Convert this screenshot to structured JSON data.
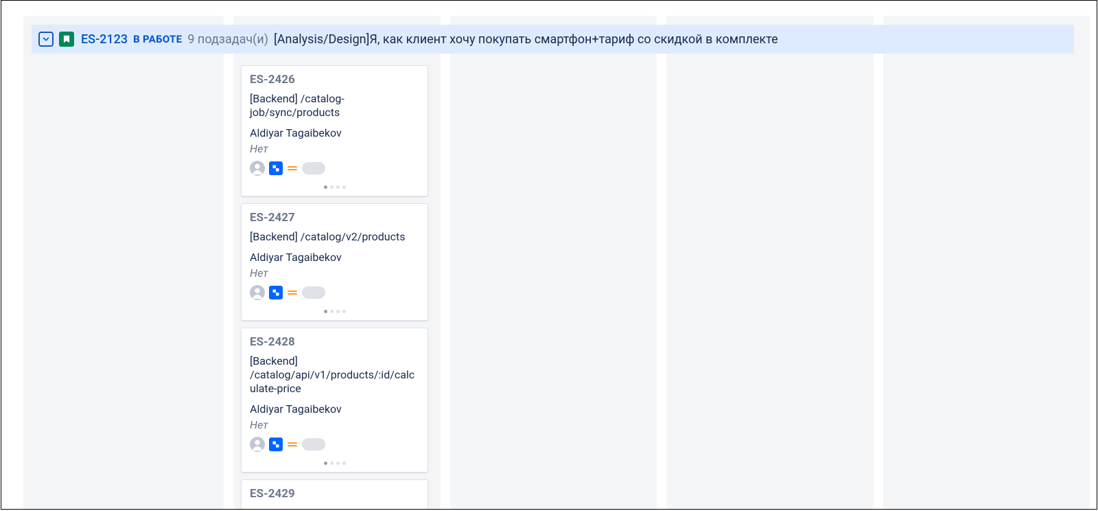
{
  "swimlane": {
    "key": "ES-2123",
    "status": "В РАБОТЕ",
    "subtask_count_label": "9 подзадач(и)",
    "summary": "[Analysis/Design]Я, как клиент хочу покупать смартфон+тариф со скидкой в комплекте"
  },
  "cards": [
    {
      "key": "ES-2426",
      "summary": "[Backend] /catalog-job/sync/products",
      "assignee": "Aldiyar Tagaibekov",
      "none_label": "Нет"
    },
    {
      "key": "ES-2427",
      "summary": "[Backend] /catalog/v2/products",
      "assignee": "Aldiyar Tagaibekov",
      "none_label": "Нет"
    },
    {
      "key": "ES-2428",
      "summary": "[Backend] /catalog/api/v1/products/:id/calculate-price",
      "assignee": "Aldiyar Tagaibekov",
      "none_label": "Нет"
    },
    {
      "key": "ES-2429",
      "summary": "",
      "assignee": "",
      "none_label": ""
    }
  ]
}
